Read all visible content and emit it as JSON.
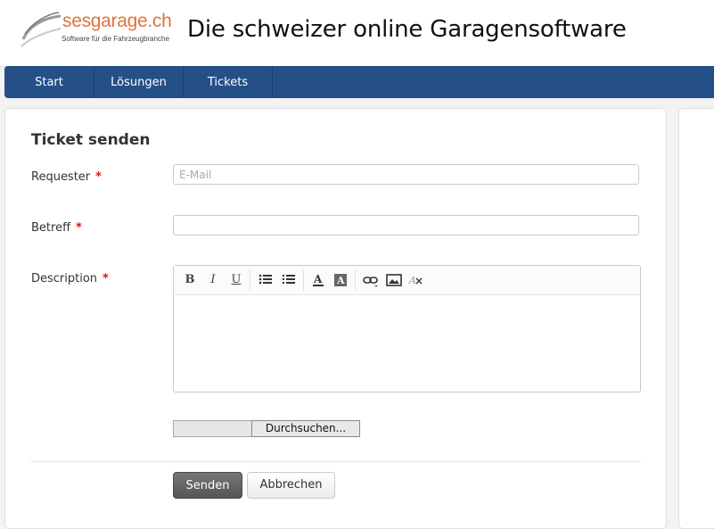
{
  "header": {
    "logo_name": "sesgarage.ch",
    "logo_tagline": "Software für die Fahrzeugbranche",
    "title": "Die schweizer online Garagensoftware"
  },
  "nav": {
    "items": [
      {
        "label": "Start"
      },
      {
        "label": "Lösungen"
      },
      {
        "label": "Tickets"
      }
    ]
  },
  "form": {
    "title": "Ticket senden",
    "requester": {
      "label": "Requester",
      "required_mark": "*",
      "placeholder": "E-Mail",
      "value": ""
    },
    "subject": {
      "label": "Betreff",
      "required_mark": "*",
      "value": ""
    },
    "description": {
      "label": "Description",
      "required_mark": "*",
      "toolbar": {
        "bold": "B",
        "italic": "I",
        "underline": "U",
        "icons": [
          "bullet-list-icon",
          "numbered-list-icon",
          "font-color-icon",
          "background-color-icon",
          "link-icon",
          "image-icon",
          "clear-format-icon"
        ]
      }
    },
    "file": {
      "browse_label": "Durchsuchen..."
    },
    "actions": {
      "submit_label": "Senden",
      "cancel_label": "Abbrechen"
    }
  },
  "colors": {
    "navbar": "#245087",
    "logo_orange": "#e2733b",
    "required": "#dd1111"
  }
}
